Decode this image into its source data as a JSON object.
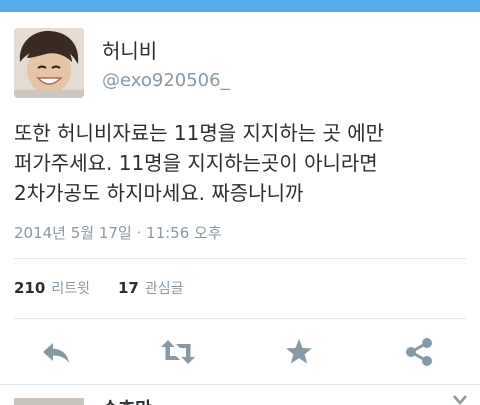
{
  "user": {
    "display_name": "허니비",
    "handle": "@exo920506_"
  },
  "tweet": {
    "lines": [
      "또한 허니비자료는 11명을 지지하는 곳 에만",
      "퍼가주세요. 11명을 지지하는곳이 아니라면",
      "2차가공도 하지마세요. 짜증나니까"
    ],
    "timestamp": "2014년 5월 17일 · 11:56 오후"
  },
  "stats": {
    "retweets_count": "210",
    "retweets_label": "리트윗",
    "favorites_count": "17",
    "favorites_label": "관심글"
  },
  "actions": {
    "reply_icon": "reply-icon",
    "retweet_icon": "retweet-icon",
    "favorite_icon": "star-icon",
    "share_icon": "share-icon"
  },
  "next_item": {
    "name_partial": "순호만"
  },
  "colors": {
    "top_bar": "#55acee",
    "text": "#292f33",
    "muted": "#8899a6",
    "divider": "#e1e8ed",
    "icon": "#8899a6"
  }
}
